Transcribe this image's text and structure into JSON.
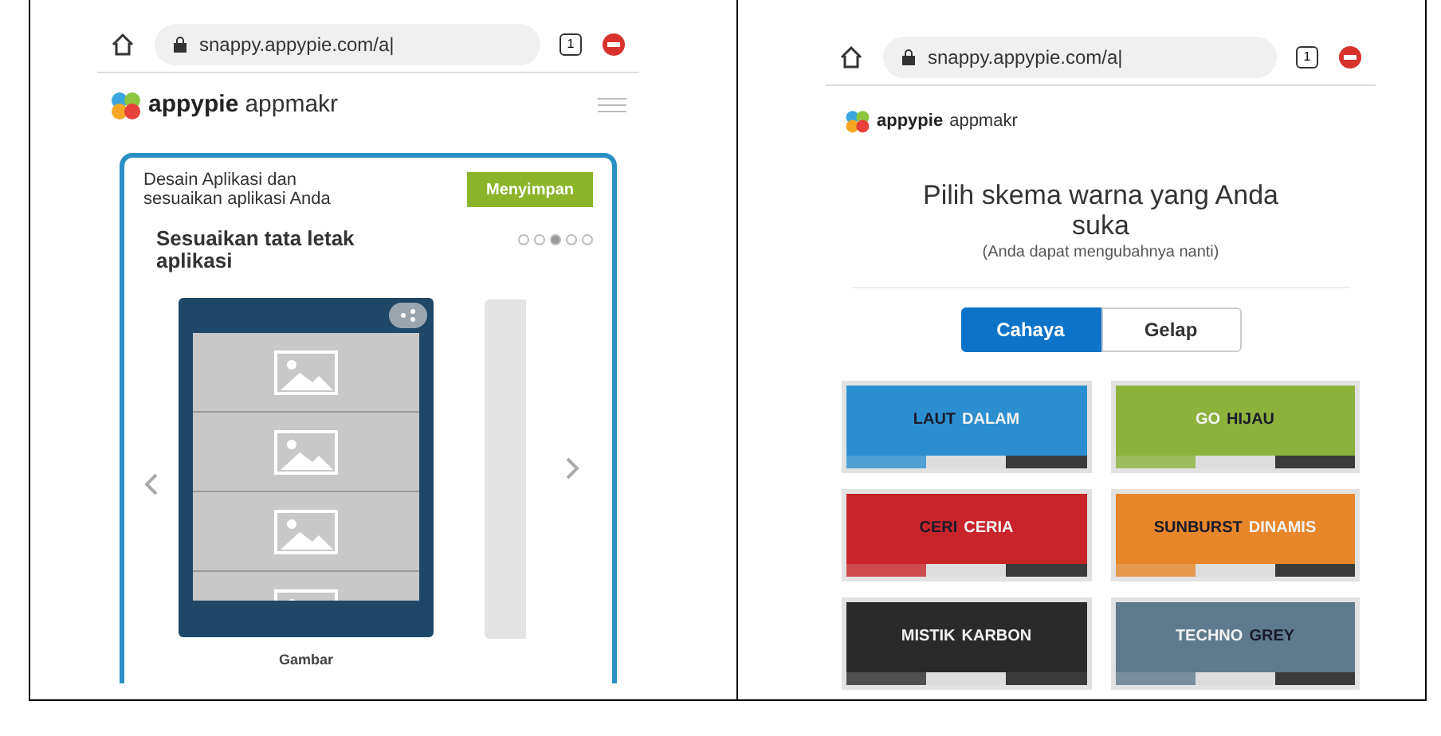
{
  "left_screen": {
    "browser": {
      "url": "snappy.appypie.com/a|",
      "tab_count": "1"
    },
    "logo": {
      "brand": "appypie",
      "product": "appmakr"
    },
    "card": {
      "intro": "Desain Aplikasi dan sesuaikan aplikasi Anda",
      "save_button": "Menyimpan",
      "step_title": "Sesuaikan tata letak aplikasi",
      "steps": [
        {
          "selected": false
        },
        {
          "selected": false
        },
        {
          "selected": true
        },
        {
          "selected": false
        },
        {
          "selected": false
        }
      ],
      "layout_caption": "Gambar"
    }
  },
  "right_screen": {
    "browser": {
      "url": "snappy.appypie.com/a|",
      "tab_count": "1"
    },
    "logo": {
      "brand": "appypie",
      "product": "appmakr"
    },
    "heading": "Pilih skema warna yang Anda suka",
    "subheading": "(Anda dapat mengubahnya nanti)",
    "modes": [
      {
        "label": "Cahaya",
        "selected": true
      },
      {
        "label": "Gelap",
        "selected": false
      }
    ],
    "themes": [
      {
        "color": "#2b8fcf",
        "words": [
          {
            "text": "LAUT",
            "kind": "dark"
          },
          {
            "text": "DALAM",
            "kind": "light"
          }
        ]
      },
      {
        "color": "#8db23c",
        "words": [
          {
            "text": "GO",
            "kind": "light"
          },
          {
            "text": "HIJAU",
            "kind": "dark"
          }
        ]
      },
      {
        "color": "#c8252a",
        "words": [
          {
            "text": "CERI",
            "kind": "dark"
          },
          {
            "text": "CERIA",
            "kind": "light"
          }
        ]
      },
      {
        "color": "#e8862a",
        "words": [
          {
            "text": "SUNBURST",
            "kind": "dark"
          },
          {
            "text": "DINAMIS",
            "kind": "light"
          }
        ]
      },
      {
        "color": "#2a2a2a",
        "words": [
          {
            "text": "MISTIK",
            "kind": "light"
          },
          {
            "text": "KARBON",
            "kind": "light"
          }
        ]
      },
      {
        "color": "#5f7a8c",
        "words": [
          {
            "text": "TECHNO",
            "kind": "light"
          },
          {
            "text": "GREY",
            "kind": "dark"
          }
        ]
      }
    ]
  }
}
